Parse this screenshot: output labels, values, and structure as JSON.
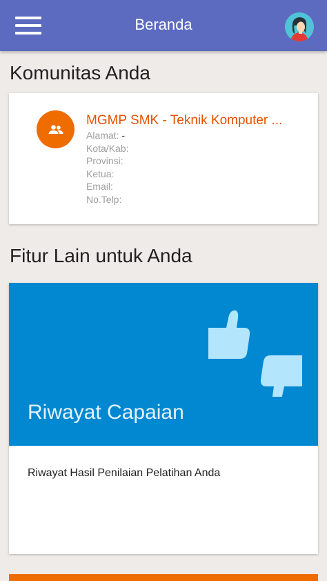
{
  "app_bar": {
    "title": "Beranda",
    "menu_icon": "hamburger-menu-icon",
    "avatar_icon": "user-avatar-icon",
    "color": "#5c6bc0"
  },
  "community_section": {
    "title": "Komunitas Anda",
    "card": {
      "icon": "group-icon",
      "icon_color": "#ef6c00",
      "name": "MGMP SMK - Teknik Komputer ...",
      "fields": [
        {
          "label": "Alamat",
          "sep": ": ",
          "value": "-"
        },
        {
          "label": "Kota/Kab",
          "sep": ":",
          "value": ""
        },
        {
          "label": "Provinsi",
          "sep": ":",
          "value": ""
        },
        {
          "label": "Ketua",
          "sep": ":",
          "value": ""
        },
        {
          "label": "Email",
          "sep": ":",
          "value": ""
        },
        {
          "label": "No.Telp",
          "sep": ":",
          "value": ""
        }
      ]
    }
  },
  "features_section": {
    "title": "Fitur Lain untuk Anda",
    "cards": [
      {
        "banner_title": "Riwayat Capaian",
        "description": "Riwayat Hasil Penilaian Pelatihan Anda",
        "icon": "thumbs-up-down-icon",
        "banner_color": "#0288d1"
      }
    ],
    "next_card_color": "#ef6c00"
  }
}
